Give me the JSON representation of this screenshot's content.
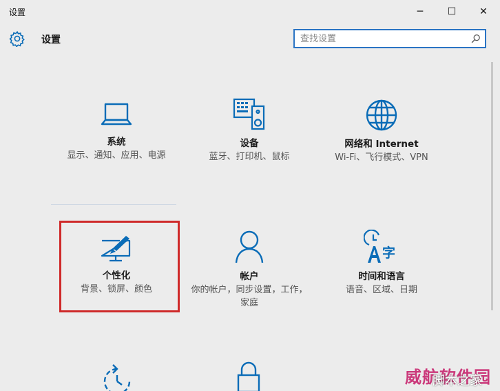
{
  "window": {
    "title": "设置",
    "minimize": "─",
    "maximize": "☐",
    "close": "✕"
  },
  "header": {
    "title": "设置",
    "search_placeholder": "查找设置"
  },
  "tiles": [
    {
      "name": "系统",
      "desc": "显示、通知、应用、电源",
      "icon": "laptop-icon"
    },
    {
      "name": "设备",
      "desc": "蓝牙、打印机、鼠标",
      "icon": "devices-icon"
    },
    {
      "name": "网络和 Internet",
      "desc": "Wi-Fi、飞行模式、VPN",
      "icon": "globe-icon"
    },
    {
      "name": "个性化",
      "desc": "背景、锁屏、颜色",
      "icon": "personalization-icon"
    },
    {
      "name": "帐户",
      "desc": "你的帐户，同步设置，工作，家庭",
      "icon": "person-icon"
    },
    {
      "name": "时间和语言",
      "desc": "语音、区域、日期",
      "icon": "time-language-icon"
    }
  ],
  "partial_tiles": [
    {
      "icon": "update-security-icon"
    },
    {
      "icon": "ease-of-access-icon"
    }
  ],
  "accent_color": "#0a6cb7",
  "highlight_color": "#cf2a2a",
  "watermark": {
    "brand": "威航软件园",
    "sub": "脚本之家"
  }
}
